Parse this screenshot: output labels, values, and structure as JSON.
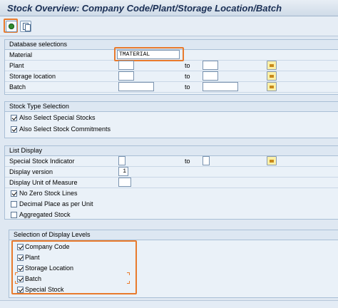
{
  "window": {
    "title": "Stock Overview: Company Code/Plant/Storage Location/Batch"
  },
  "toolbar": {
    "execute_icon": "execute-icon",
    "copy_icon": "copy-variant-icon"
  },
  "database_selections": {
    "title": "Database selections",
    "rows": [
      {
        "label": "Material",
        "value": "TMATERIAL",
        "to_label": ""
      },
      {
        "label": "Plant",
        "value": "",
        "to_label": "to"
      },
      {
        "label": "Storage location",
        "value": "",
        "to_label": "to"
      },
      {
        "label": "Batch",
        "value": "",
        "to_label": "to"
      }
    ]
  },
  "stock_type": {
    "title": "Stock Type Selection",
    "options": [
      {
        "label": "Also Select Special Stocks",
        "checked": true
      },
      {
        "label": "Also Select Stock Commitments",
        "checked": true
      }
    ]
  },
  "list_display": {
    "title": "List Display",
    "special_stock_label": "Special Stock Indicator",
    "special_stock_to": "to",
    "display_version_label": "Display version",
    "display_version_value": "1",
    "uom_label": "Display Unit of Measure",
    "options": [
      {
        "label": "No Zero Stock Lines",
        "checked": true
      },
      {
        "label": "Decimal Place as per Unit",
        "checked": false
      },
      {
        "label": "Aggregated Stock",
        "checked": false
      }
    ]
  },
  "display_levels": {
    "title": "Selection of Display Levels",
    "options": [
      {
        "label": "Company Code",
        "checked": true
      },
      {
        "label": "Plant",
        "checked": true
      },
      {
        "label": "Storage Location",
        "checked": true
      },
      {
        "label": "Batch",
        "checked": true
      },
      {
        "label": "Special Stock",
        "checked": true
      }
    ]
  },
  "colors": {
    "highlight": "#e87a2c",
    "background": "#dfe8f2",
    "title_text": "#1a2f55"
  }
}
